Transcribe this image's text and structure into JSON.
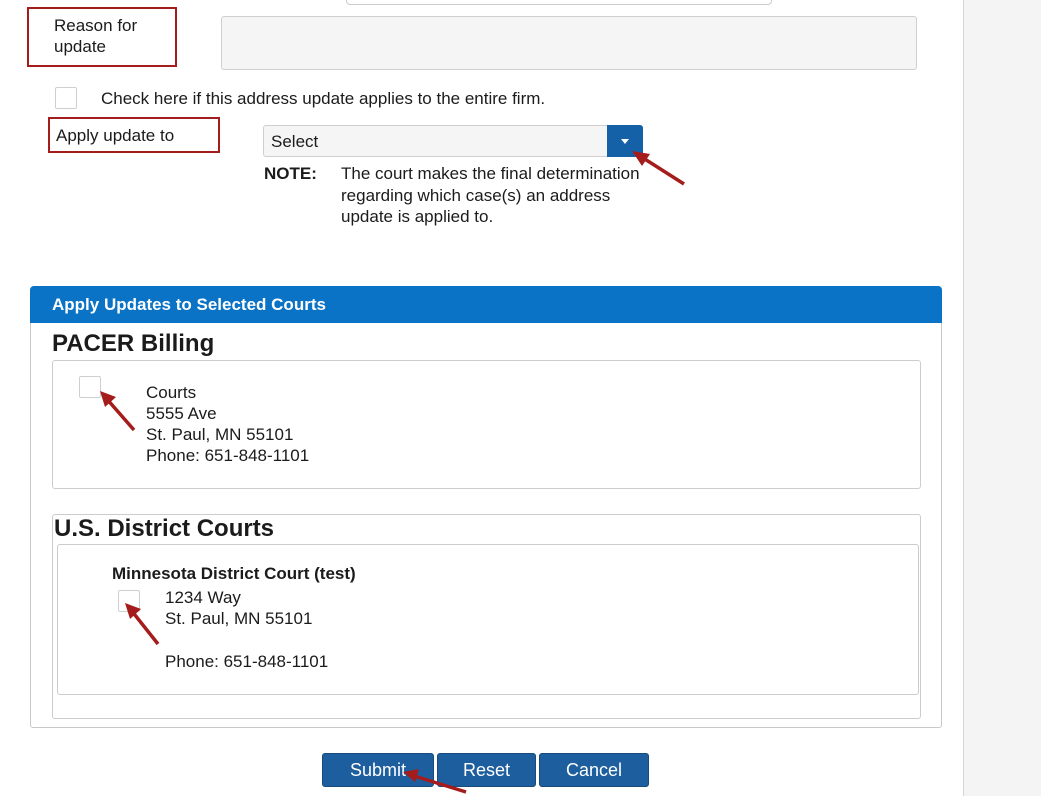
{
  "form": {
    "reason_label": "Reason for update",
    "reason_value": "",
    "firm_check_label": "Check here if this address update applies to the entire firm.",
    "apply_label": "Apply update to",
    "apply_select_value": "Select",
    "note_label": "NOTE:",
    "note_text": "The court makes the final determination regarding which case(s) an address update is applied to."
  },
  "panel": {
    "header": "Apply Updates to Selected Courts",
    "pacer": {
      "title": "PACER Billing",
      "lines": [
        "Courts",
        "5555 Ave",
        "St. Paul, MN 55101",
        "Phone: 651-848-1101"
      ]
    },
    "district": {
      "title": "U.S. District Courts",
      "court_name": "Minnesota District Court (test)",
      "lines": [
        "1234 Way",
        "St. Paul, MN 55101"
      ],
      "phone": "Phone: 651-848-1101"
    }
  },
  "buttons": {
    "submit": "Submit",
    "reset": "Reset",
    "cancel": "Cancel"
  },
  "colors": {
    "panel_header": "#0b73c5",
    "button": "#1d5e9e",
    "select_toggle": "#1461a8",
    "callout_border": "#a51c1c",
    "arrow": "#a51c1c"
  },
  "icons": {
    "select_toggle": "chevron-down-icon",
    "annotation": "arrow-annotation-icon"
  }
}
